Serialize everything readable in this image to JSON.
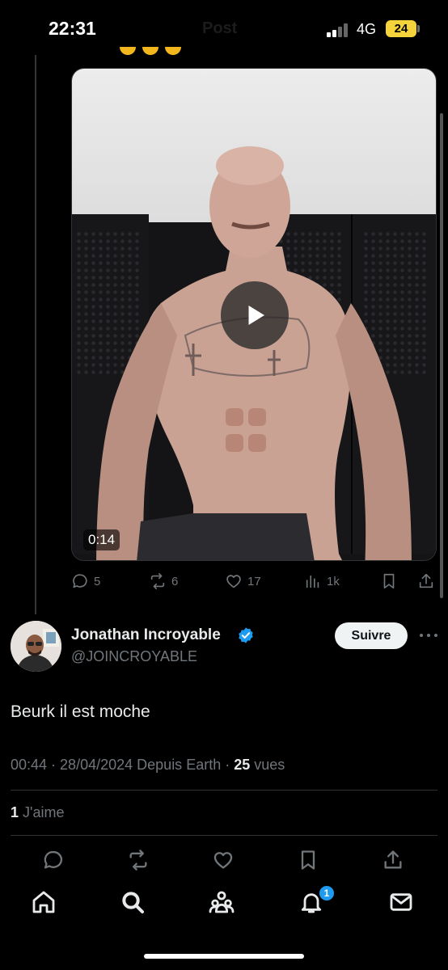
{
  "status_bar": {
    "time": "22:31",
    "network": "4G",
    "battery": "24",
    "screen_title": "Post"
  },
  "video": {
    "duration": "0:14",
    "play_icon": "play-icon"
  },
  "reply_actions": {
    "replies": "5",
    "reposts": "6",
    "likes": "17",
    "views": "1k"
  },
  "tweet": {
    "author_name": "Jonathan Incroyable",
    "handle": "@JOINCROYABLE",
    "follow_label": "Suivre",
    "text": "Beurk il est moche",
    "time": "00:44",
    "date": "28/04/2024",
    "source": "Depuis Earth",
    "views_count": "25",
    "views_label": "vues",
    "likes_count": "1",
    "likes_label": "J'aime"
  },
  "tabbar": {
    "notification_count": "1"
  },
  "colors": {
    "background": "#000000",
    "text_primary": "#e7e9ea",
    "text_secondary": "#71767b",
    "accent": "#1d9bf0",
    "battery": "#f5d43b"
  }
}
